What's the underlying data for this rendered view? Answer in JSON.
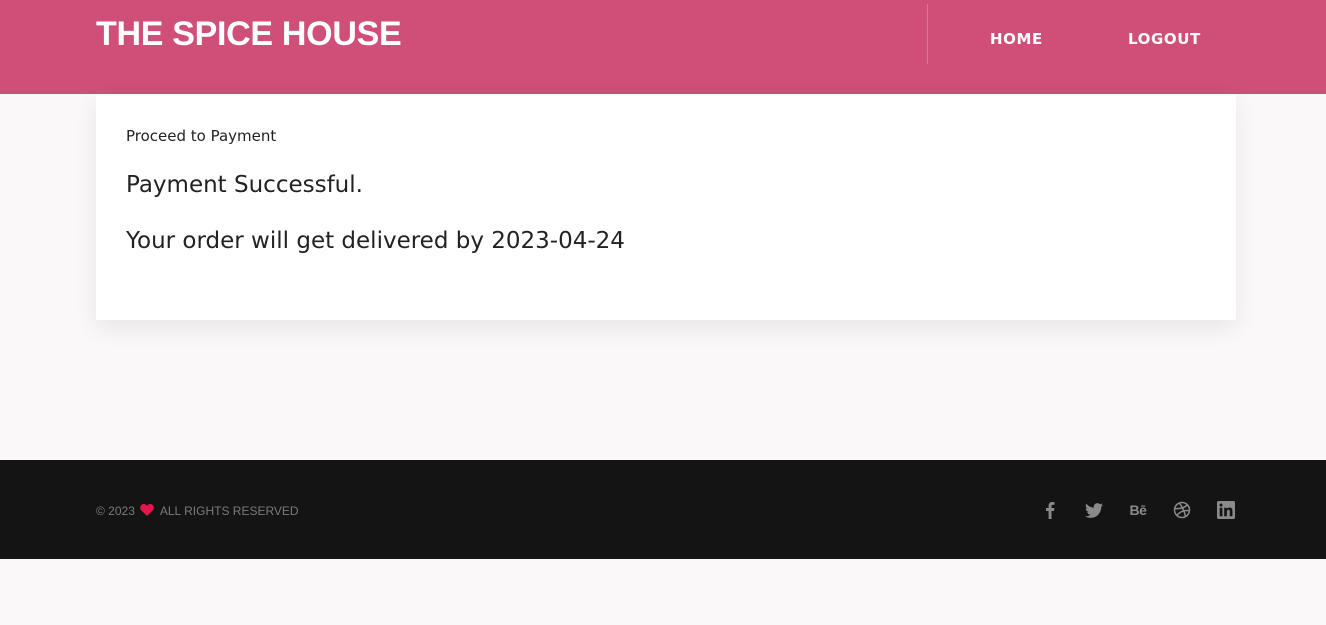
{
  "header": {
    "brand": "THE SPICE HOUSE",
    "nav": {
      "home": "HOME",
      "logout": "LOGOUT"
    }
  },
  "main": {
    "label": "Proceed to Payment",
    "status": "Payment Successful.",
    "delivery": "Your order will get delivered by 2023-04-24"
  },
  "footer": {
    "copyright": "© 2023",
    "rights": "ALL RIGHTS RESERVED",
    "social": [
      "facebook-icon",
      "twitter-icon",
      "behance-icon",
      "dribbble-icon",
      "linkedin-icon"
    ],
    "behance_glyph": "Bē"
  },
  "colors": {
    "header_bg": "#d04f78",
    "footer_bg": "#141414",
    "heart": "#e0194a",
    "page_bg": "#faf8f9"
  }
}
